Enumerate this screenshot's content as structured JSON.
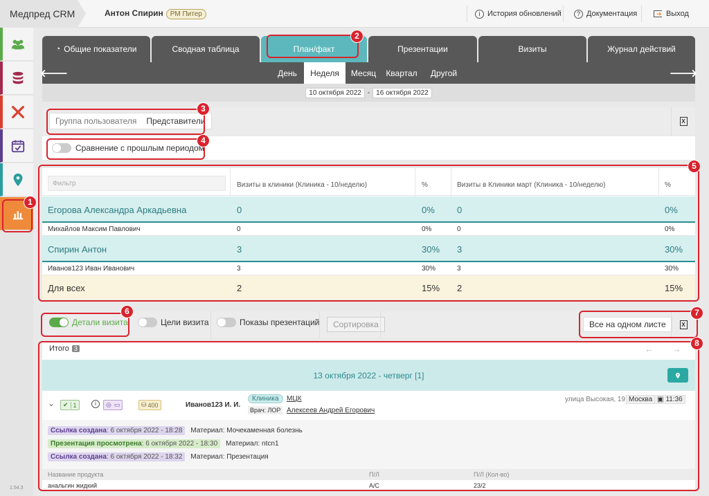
{
  "app": {
    "brand": "Медпред CRM",
    "user": "Антон Спирин",
    "user_badge": "РМ Питер"
  },
  "topbar": {
    "updates": "История обновлений",
    "docs": "Документация",
    "logout": "Выход"
  },
  "sidebar": {
    "version": "1.54.3",
    "items": [
      {
        "icon": "users-icon",
        "color": "#5aaa4a"
      },
      {
        "icon": "database-icon",
        "color": "#a4294f"
      },
      {
        "icon": "tools-icon",
        "color": "#d9402d"
      },
      {
        "icon": "calendar-check-icon",
        "color": "#5c3f8f"
      },
      {
        "icon": "map-pin-icon",
        "color": "#2a9d9f"
      },
      {
        "icon": "chart-icon",
        "color": "#ee8a3a"
      }
    ]
  },
  "tabs": [
    "Общие показатели",
    "Сводная таблица",
    "План/факт",
    "Презентации",
    "Визиты",
    "Журнал действий"
  ],
  "periods": [
    "День",
    "Неделя",
    "Месяц",
    "Квартал",
    "Другой"
  ],
  "active_period": "Неделя",
  "date_from": "10 октября 2022",
  "date_to": "16 октября 2022",
  "date_sep": "-",
  "group": {
    "label": "Группа пользователя",
    "value": "Представители"
  },
  "compare_label": "Сравнение с прошлым периодом",
  "table": {
    "filter_placeholder": "Фильтр",
    "headers": [
      "Визиты в клиники (Клиника - 10/неделю)",
      "%",
      "Визиты в Клиники март (Клиника - 10/неделю)",
      "%"
    ],
    "rows": [
      {
        "name": "Егорова Александра Аркадьевна",
        "v1": "0",
        "p1": "0%",
        "v2": "0",
        "p2": "0%",
        "type": "big"
      },
      {
        "name": "Михайлов Максим Павлович",
        "v1": "0",
        "p1": "0%",
        "v2": "0",
        "p2": "0%",
        "type": "small"
      },
      {
        "name": "Спирин Антон",
        "v1": "3",
        "p1": "30%",
        "v2": "3",
        "p2": "30%",
        "type": "big"
      },
      {
        "name": "Иванов123 Иван Иванович",
        "v1": "3",
        "p1": "30%",
        "v2": "3",
        "p2": "30%",
        "type": "small"
      },
      {
        "name": "Для всех",
        "v1": "2",
        "p1": "15%",
        "v2": "2",
        "p2": "15%",
        "type": "all"
      }
    ]
  },
  "toggles": {
    "details": "Детали визита",
    "goals": "Цели визита",
    "presentations": "Показы презентаций",
    "sort": "Сортировка",
    "all_one_sheet": "Все на одном листе"
  },
  "visits": {
    "total_label": "Итого",
    "total_count": "3",
    "day_header": "13 октября 2022 - четверг [1]",
    "visit": {
      "check_count": "1",
      "coins": "400",
      "rep": "Иванов123 И. И.",
      "type_badge": "Клиника",
      "clinic": "МЦК",
      "doctor_label": "Врач: ЛОР",
      "doctor": "Алексеев Андрей Егорович",
      "address": "улица Высокая, 19",
      "city": "Москва",
      "time": "11:36"
    },
    "events": [
      {
        "label": "Ссылка создана",
        "date": ": 6 октября 2022 - 18:28",
        "material": "Материал: Мочекаменная болезнь",
        "kind": "link"
      },
      {
        "label": "Презентация просмотрена",
        "date": ": 6 октября 2022 - 18:30",
        "material": "Материал: ntcn1",
        "kind": "pres"
      },
      {
        "label": "Ссылка создана",
        "date": ": 6 октября 2022 - 18:32",
        "material": "Материал: Презентация",
        "kind": "link"
      }
    ],
    "products": {
      "headers": [
        "Название продукта",
        "П/Л",
        "П/Л (Кол-во)"
      ],
      "rows": [
        {
          "name": "анальгин жидкий",
          "pl": "А/С",
          "qty": "23/2"
        }
      ]
    }
  },
  "annotations": [
    "1",
    "2",
    "3",
    "4",
    "5",
    "6",
    "7",
    "8"
  ],
  "colors": {
    "accent": "#5cb8bc",
    "red": "#d9232d",
    "tab": "#585858",
    "green": "#5aaa4a"
  }
}
